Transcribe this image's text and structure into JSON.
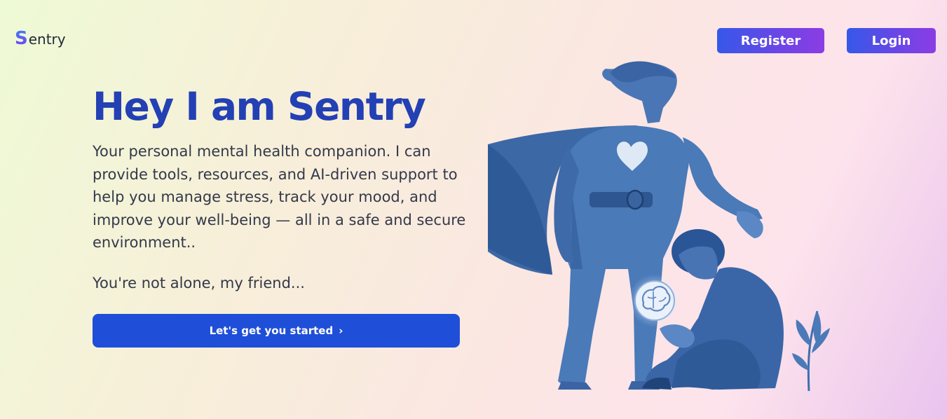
{
  "header": {
    "logo_initial": "S",
    "logo_rest": "entry",
    "register_label": "Register",
    "login_label": "Login"
  },
  "hero": {
    "title": "Hey I am Sentry",
    "description": "Your personal mental health companion. I can provide tools, resources, and AI-driven support to help you manage stress, track your mood, and improve your well-being — all in a safe and secure environment..",
    "subtitle": "You're not alone, my friend...",
    "cta_label": "Let's get you started",
    "cta_icon": "chevron-right-icon"
  },
  "illustration": {
    "name": "superhero-comforting-person-illustration",
    "icons": [
      "heart-icon",
      "brain-icon",
      "plant-icon"
    ]
  },
  "colors": {
    "brand": "#2340b4",
    "cta": "#1f4fd8",
    "nav_gradient_start": "#3558e8",
    "nav_gradient_end": "#8b3de4",
    "illustration_blue": "#3f6fae"
  }
}
